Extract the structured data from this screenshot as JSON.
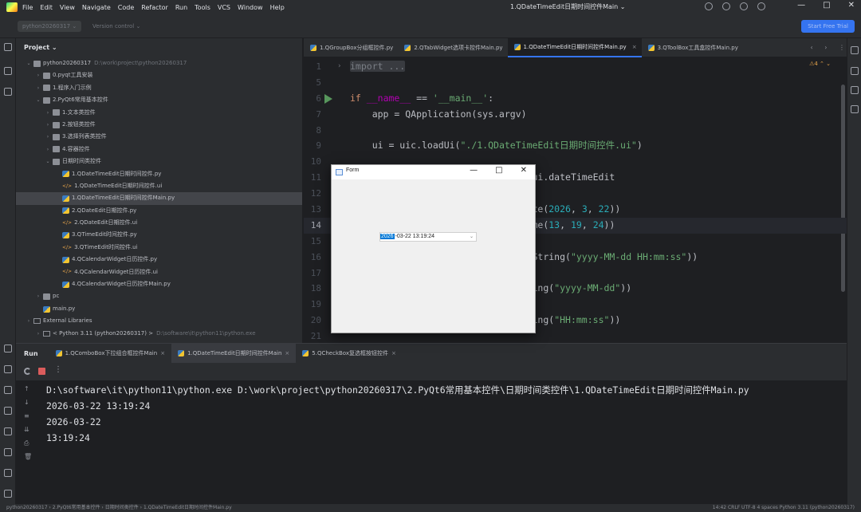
{
  "menubar": {
    "items": [
      "File",
      "Edit",
      "View",
      "Navigate",
      "Code",
      "Refactor",
      "Run",
      "Tools",
      "VCS",
      "Window",
      "Help"
    ],
    "run_config": "1.QDateTimeEdit日期时间控件Main ⌄",
    "window_controls": [
      "—",
      "□",
      "✕"
    ]
  },
  "toolbar": {
    "project_chip": "python20260317 ⌄",
    "vcs_chip": "Version control ⌄",
    "trial_button": "Start Free Trial"
  },
  "project_panel": {
    "title": "Project ⌄",
    "tree": [
      {
        "indent": 0,
        "chev": "⌄",
        "icon": "folder",
        "label": "python20260317",
        "path": "D:\\work\\project\\python20260317"
      },
      {
        "indent": 1,
        "chev": "›",
        "icon": "folder",
        "label": "0.pyqt工具安装"
      },
      {
        "indent": 1,
        "chev": "›",
        "icon": "folder",
        "label": "1.程序入门示例"
      },
      {
        "indent": 1,
        "chev": "⌄",
        "icon": "folder",
        "label": "2.PyQt6常用基本控件"
      },
      {
        "indent": 2,
        "chev": "›",
        "icon": "folder",
        "label": "1.文本类控件"
      },
      {
        "indent": 2,
        "chev": "›",
        "icon": "folder",
        "label": "2.按钮类控件"
      },
      {
        "indent": 2,
        "chev": "›",
        "icon": "folder",
        "label": "3.选择列表类控件"
      },
      {
        "indent": 2,
        "chev": "›",
        "icon": "folder",
        "label": "4.容器控件"
      },
      {
        "indent": 2,
        "chev": "⌄",
        "icon": "folder",
        "label": "日期时间类控件"
      },
      {
        "indent": 3,
        "chev": "",
        "icon": "py",
        "label": "1.QDateTimeEdit日期时间控件.py"
      },
      {
        "indent": 3,
        "chev": "",
        "icon": "ui",
        "label": "1.QDateTimeEdit日期时间控件.ui"
      },
      {
        "indent": 3,
        "chev": "",
        "icon": "py",
        "label": "1.QDateTimeEdit日期时间控件Main.py",
        "selected": true
      },
      {
        "indent": 3,
        "chev": "",
        "icon": "py",
        "label": "2.QDateEdit日期控件.py"
      },
      {
        "indent": 3,
        "chev": "",
        "icon": "ui",
        "label": "2.QDateEdit日期控件.ui"
      },
      {
        "indent": 3,
        "chev": "",
        "icon": "py",
        "label": "3.QTimeEdit时间控件.py"
      },
      {
        "indent": 3,
        "chev": "",
        "icon": "ui",
        "label": "3.QTimeEdit时间控件.ui"
      },
      {
        "indent": 3,
        "chev": "",
        "icon": "py",
        "label": "4.QCalendarWidget日历控件.py"
      },
      {
        "indent": 3,
        "chev": "",
        "icon": "ui",
        "label": "4.QCalendarWidget日历控件.ui"
      },
      {
        "indent": 3,
        "chev": "",
        "icon": "py",
        "label": "4.QCalendarWidget日历控件Main.py"
      },
      {
        "indent": 1,
        "chev": "›",
        "icon": "folder",
        "label": "pc"
      },
      {
        "indent": 1,
        "chev": "",
        "icon": "py",
        "label": "main.py"
      },
      {
        "indent": 0,
        "chev": "›",
        "icon": "lib",
        "label": "External Libraries"
      },
      {
        "indent": 1,
        "chev": "›",
        "icon": "lib",
        "label": "< Python 3.11 (python20260317) >",
        "path": "D:\\software\\it\\python11\\python.exe"
      }
    ]
  },
  "editor": {
    "tabs": [
      {
        "label": "1.QGroupBox分组框控件.py",
        "active": false
      },
      {
        "label": "2.QTabWidget选项卡控件Main.py",
        "active": false
      },
      {
        "label": "1.QDateTimeEdit日期时间控件Main.py",
        "active": true
      },
      {
        "label": "3.QToolBox工具盒控件Main.py",
        "active": false
      }
    ],
    "tab_controls": "‹ › ⋮",
    "inspection": "⚠4 ⌃ ⌄",
    "lines": [
      {
        "n": "1",
        "html": "<span class=\"kw fold\">import ...</span>"
      },
      {
        "n": "5",
        "html": ""
      },
      {
        "n": "6",
        "html": "<span class=\"kw\">if</span> <span class=\"dunder\">__name__</span> == <span class=\"str\">'__main__'</span>:",
        "run": true
      },
      {
        "n": "7",
        "html": "    app = QApplication(sys.argv)"
      },
      {
        "n": "8",
        "html": ""
      },
      {
        "n": "9",
        "html": "    ui = uic.loadUi(<span class=\"str\">\"./1.QDateTimeEdit日期时间控件.ui\"</span>)"
      },
      {
        "n": "10",
        "html": ""
      },
      {
        "n": "11",
        "html": "                               = ui.dateTimeEdit"
      },
      {
        "n": "12",
        "html": ""
      },
      {
        "n": "13",
        "html": "                              QDate(<span class=\"num\">2026</span>, <span class=\"num\">3</span>, <span class=\"num\">22</span>))"
      },
      {
        "n": "14",
        "html": "                              QTime(<span class=\"num\">13</span>, <span class=\"num\">19</span>, <span class=\"num\">24</span>))",
        "current": true
      },
      {
        "n": "15",
        "html": ""
      },
      {
        "n": "16",
        "html": "                             ).toString(<span class=\"str\">\"yyyy-MM-dd HH:mm:ss\"</span>))"
      },
      {
        "n": "17",
        "html": ""
      },
      {
        "n": "18",
        "html": "                              String(<span class=\"str\">\"yyyy-MM-dd\"</span>))"
      },
      {
        "n": "19",
        "html": ""
      },
      {
        "n": "20",
        "html": "                              String(<span class=\"str\">\"HH:mm:ss\"</span>))"
      },
      {
        "n": "21",
        "html": ""
      }
    ]
  },
  "run_panel": {
    "label": "Run",
    "tabs": [
      {
        "label": "1.QComboBox下拉组合框控件Main",
        "active": false
      },
      {
        "label": "1.QDateTimeEdit日期时间控件Main",
        "active": true
      },
      {
        "label": "5.QCheckBox复选框按钮控件",
        "active": false
      }
    ],
    "more": "⋮",
    "side_icons": [
      "↑",
      "↓",
      "≡",
      "⇊",
      "⎙",
      "🗑"
    ],
    "output": [
      "D:\\software\\it\\python11\\python.exe D:\\work\\project\\python20260317\\2.PyQt6常用基本控件\\日期时间类控件\\1.QDateTimeEdit日期时间控件Main.py",
      "2026-03-22 13:19:24",
      "2026-03-22",
      "13:19:24"
    ]
  },
  "form_window": {
    "title": "Form",
    "controls": [
      "—",
      "□",
      "✕"
    ],
    "datetime_year": "2026",
    "datetime_rest": "-03-22 13:19:24",
    "dropdown_arrow": "⌄"
  },
  "statusbar": {
    "left": "python20260317 › 2.PyQt6常用基本控件 › 日期时间类控件 › 1.QDateTimeEdit日期时间控件Main.py",
    "right": "14:42   CRLF   UTF-8   4 spaces   Python 3.11 (python20260317)"
  }
}
